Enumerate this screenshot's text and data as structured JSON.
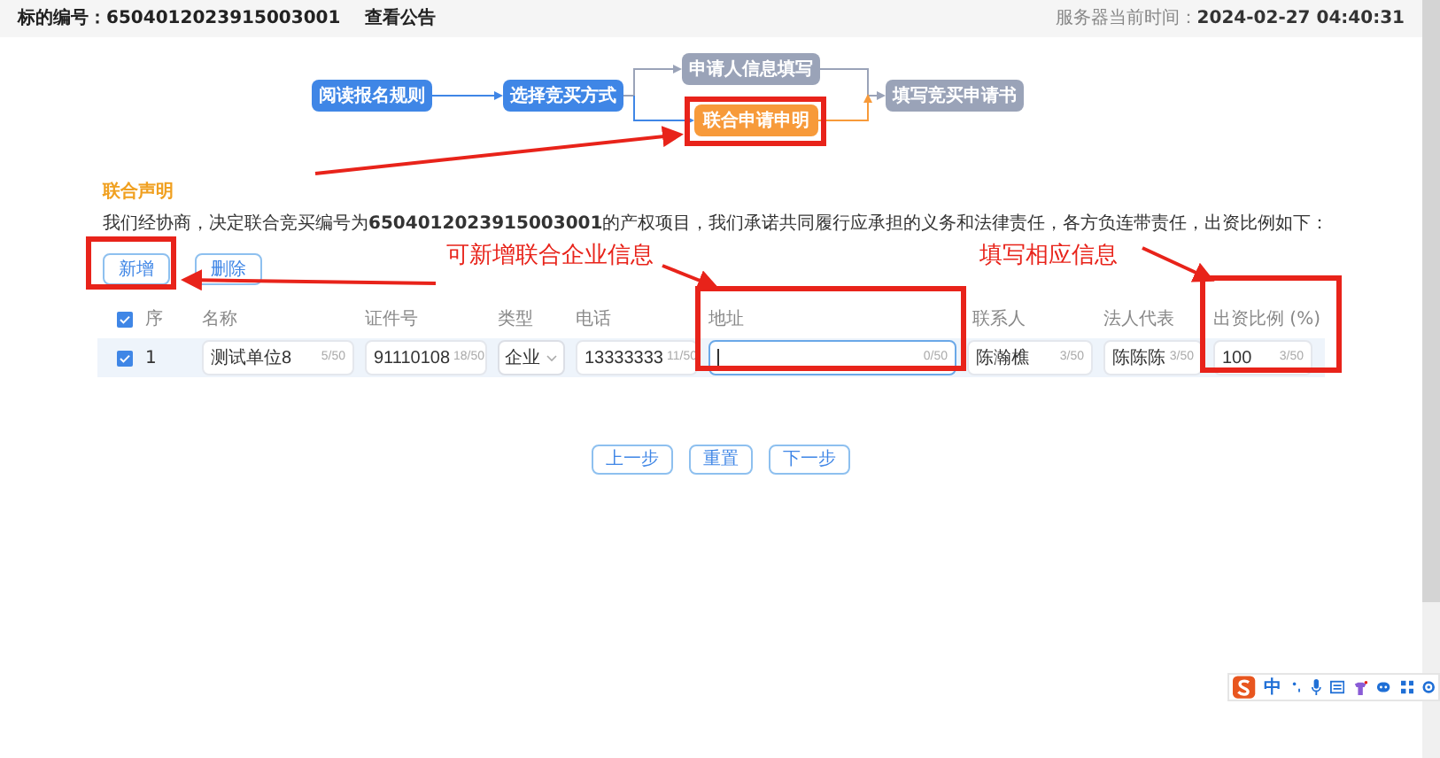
{
  "header": {
    "label": "标的编号：",
    "code": "6504012023915003001",
    "link": "查看公告",
    "server_time_label": "服务器当前时间：",
    "server_time": "2024-02-27 04:40:31"
  },
  "flow": [
    {
      "label": "阅读报名规则",
      "kind": "done"
    },
    {
      "label": "选择竞买方式",
      "kind": "done"
    },
    {
      "label": "申请人信息填写",
      "kind": "todo"
    },
    {
      "label": "联合申请申明",
      "kind": "current"
    },
    {
      "label": "填写竞买申请书",
      "kind": "todo"
    }
  ],
  "section_title": "联合声明",
  "statement": "我们经协商，决定联合竞买编号为**6504012023915003001**的产权项目，我们承诺共同履行应承担的义务和法律责任，各方负连带责任，出资比例如下：",
  "actions": [
    "新增",
    "删除"
  ],
  "table": {
    "select_all": {
      "checked": true
    },
    "columns": [
      "序",
      "名称",
      "证件号",
      "类型",
      "电话",
      "地址",
      "联系人",
      "法人代表",
      "出资比例 (%)"
    ],
    "rows": [
      {
        "checked": true,
        "cells": [
          {
            "kind": "text",
            "value": "1"
          },
          {
            "kind": "input",
            "value": "测试单位8",
            "counter": "5/50",
            "focused": false
          },
          {
            "kind": "input",
            "value": "91110108",
            "counter": "18/50",
            "focused": false
          },
          {
            "kind": "select",
            "value": "企业"
          },
          {
            "kind": "input",
            "value": "13333333",
            "counter": "11/50",
            "focused": false
          },
          {
            "kind": "input",
            "counter": "0/50",
            "focused": true
          },
          {
            "kind": "input",
            "value": "陈瀚樵",
            "counter": "3/50",
            "focused": false
          },
          {
            "kind": "input",
            "value": "陈陈陈",
            "counter": "3/50",
            "focused": false
          },
          {
            "kind": "input",
            "value": "100",
            "counter": "3/50",
            "focused": false
          }
        ]
      }
    ]
  },
  "nav_buttons": [
    "上一步",
    "重置",
    "下一步"
  ],
  "annotations": [
    "可新增联合企业信息",
    "填写相应信息"
  ],
  "ime_toolbar": {
    "mode": "中"
  }
}
